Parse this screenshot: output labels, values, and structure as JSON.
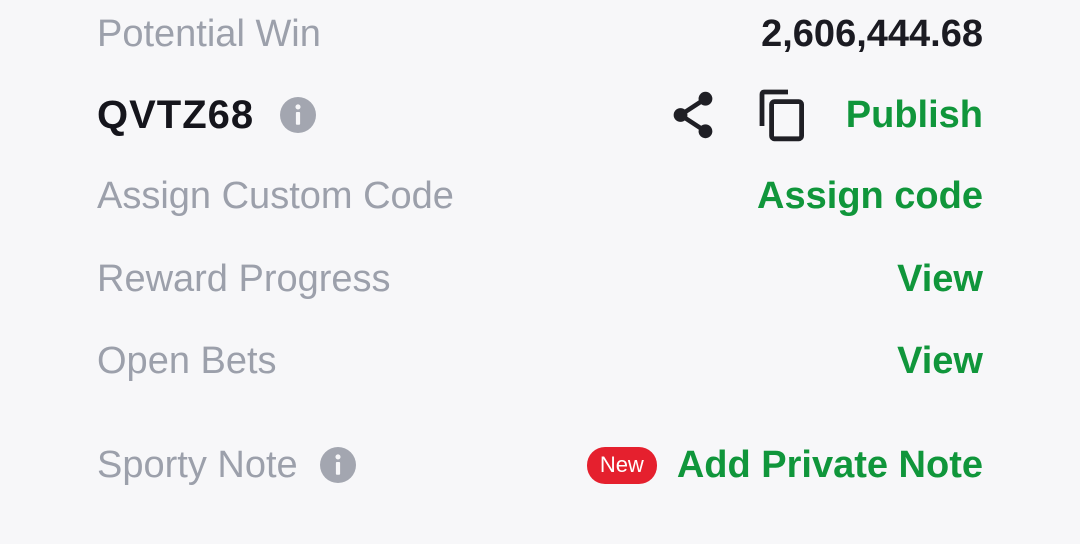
{
  "potential_win": {
    "label": "Potential Win",
    "value": "2,606,444.68"
  },
  "booking_code": {
    "code": "QVTZ68",
    "info_icon": "info-icon",
    "share_icon": "share-icon",
    "copy_icon": "copy-icon",
    "publish_label": "Publish"
  },
  "custom_code": {
    "label": "Assign Custom Code",
    "action_label": "Assign code"
  },
  "reward_progress": {
    "label": "Reward Progress",
    "action_label": "View"
  },
  "open_bets": {
    "label": "Open Bets",
    "action_label": "View"
  },
  "sporty_note": {
    "label": "Sporty Note",
    "info_icon": "info-icon",
    "badge": "New",
    "action_label": "Add Private Note"
  },
  "colors": {
    "background": "#f7f7f9",
    "label_gray": "#9ca0ab",
    "accent_green": "#10963b",
    "badge_red": "#e5202e",
    "text_dark": "#1b1b22"
  }
}
